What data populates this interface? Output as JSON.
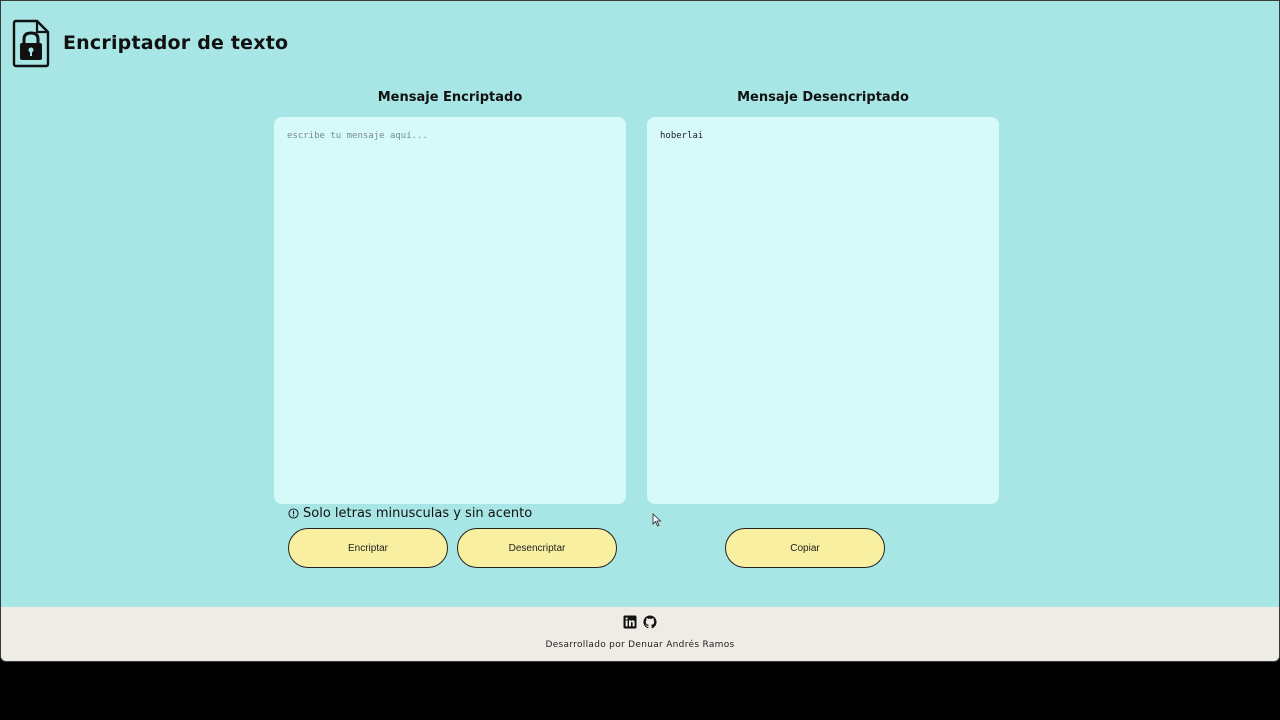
{
  "app": {
    "title": "Encriptador de texto",
    "logo_icon": "lock-document-icon"
  },
  "encrypt_panel": {
    "title": "Mensaje Encriptado",
    "placeholder": "escribe tu mensaje aquí...",
    "value": ""
  },
  "decrypt_panel": {
    "title": "Mensaje Desencriptado",
    "value": "hoberlai"
  },
  "hint": {
    "icon": "info-circle-icon",
    "text": "Solo letras minusculas y sin acento"
  },
  "buttons": {
    "encrypt_label": "Encriptar",
    "decrypt_label": "Desencriptar",
    "copy_label": "Copiar"
  },
  "footer": {
    "icons": [
      "linkedin-icon",
      "github-icon"
    ],
    "credit": "Desarrollado por Denuar Andrés Ramos"
  },
  "colors": {
    "background": "#a8e6e6",
    "panel": "#d6fafa",
    "button": "#f8f0a0",
    "footer": "#efece6"
  }
}
